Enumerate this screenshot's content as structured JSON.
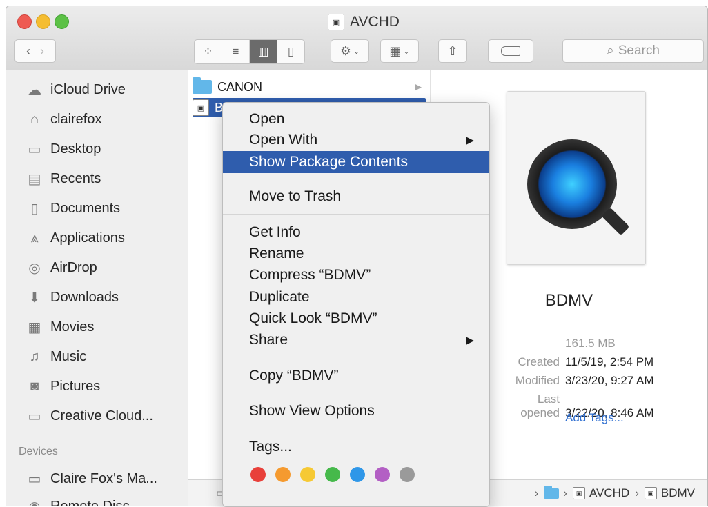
{
  "window": {
    "title": "AVCHD"
  },
  "toolbar": {
    "view_icons": [
      "icon-view-icon",
      "list-view-icon",
      "column-view-icon",
      "cover-flow-icon"
    ],
    "search_placeholder": "Search",
    "search_icon": "magnifier-icon"
  },
  "sidebar": {
    "favorites": [
      {
        "label": "iCloud Drive",
        "icon": "cloud-icon"
      },
      {
        "label": "clairefox",
        "icon": "home-icon"
      },
      {
        "label": "Desktop",
        "icon": "desktop-icon"
      },
      {
        "label": "Recents",
        "icon": "recents-icon"
      },
      {
        "label": "Documents",
        "icon": "documents-icon"
      },
      {
        "label": "Applications",
        "icon": "applications-icon"
      },
      {
        "label": "AirDrop",
        "icon": "airdrop-icon"
      },
      {
        "label": "Downloads",
        "icon": "downloads-icon"
      },
      {
        "label": "Movies",
        "icon": "movies-icon"
      },
      {
        "label": "Music",
        "icon": "music-icon"
      },
      {
        "label": "Pictures",
        "icon": "pictures-icon"
      },
      {
        "label": "Creative Cloud...",
        "icon": "folder-icon"
      }
    ],
    "devices_header": "Devices",
    "devices": [
      {
        "label": "Claire Fox's Ma...",
        "icon": "laptop-icon"
      },
      {
        "label": "Remote Disc",
        "icon": "disc-icon"
      }
    ]
  },
  "column": {
    "items": [
      {
        "label": "CANON",
        "selected": false
      },
      {
        "label": "BDMV",
        "selected": true
      }
    ]
  },
  "context_menu": {
    "items": [
      {
        "label": "Open"
      },
      {
        "label": "Open With",
        "submenu": true
      },
      {
        "label": "Show Package Contents",
        "highlighted": true
      },
      {
        "label": "Move to Trash"
      },
      {
        "label": "Get Info"
      },
      {
        "label": "Rename"
      },
      {
        "label": "Compress “BDMV”"
      },
      {
        "label": "Duplicate"
      },
      {
        "label": "Quick Look “BDMV”"
      },
      {
        "label": "Share",
        "submenu": true
      },
      {
        "label": "Copy “BDMV”"
      },
      {
        "label": "Show View Options"
      },
      {
        "label": "Tags..."
      }
    ],
    "tag_colors": [
      "#e8403a",
      "#f59a2f",
      "#f6c934",
      "#46b94b",
      "#2f97e8",
      "#b35fc4",
      "#9a9a9a"
    ]
  },
  "preview": {
    "name": "BDMV",
    "size": "161.5 MB",
    "created_label": "Created",
    "created": "11/5/19, 2:54 PM",
    "modified_label": "Modified",
    "modified": "3/23/20, 9:27 AM",
    "opened_label": "Last opened",
    "opened": "3/22/20, 8:46 AM",
    "add_tags": "Add Tags..."
  },
  "pathbar": {
    "items": [
      "AVCHD",
      "BDMV"
    ]
  },
  "colors": {
    "selection": "#2f5dad",
    "folder": "#62b7e9",
    "link": "#2f6fd1"
  }
}
